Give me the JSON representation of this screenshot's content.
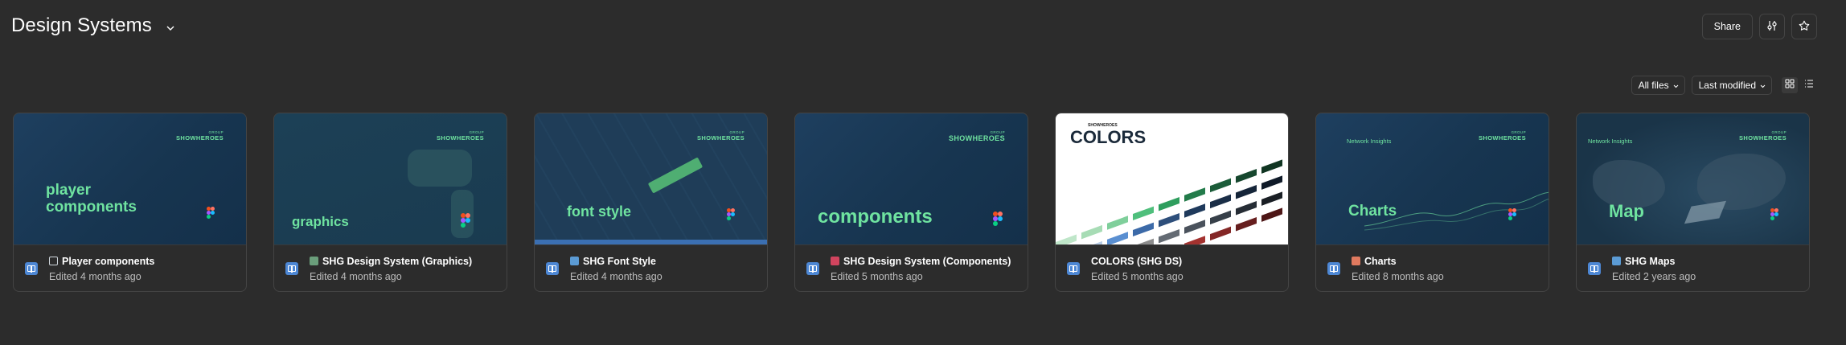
{
  "header": {
    "title": "Design Systems",
    "share_label": "Share"
  },
  "toolbar": {
    "filter_label": "All files",
    "sort_label": "Last modified"
  },
  "files": [
    {
      "title": "Player components",
      "edited": "Edited 4 months ago",
      "thumb_text": "player\ncomponents",
      "emoji_color": "#9aa4ad"
    },
    {
      "title": "SHG Design System (Graphics)",
      "edited": "Edited 4 months ago",
      "thumb_text": "graphics",
      "emoji_color": "#6a9e7b"
    },
    {
      "title": "SHG Font Style",
      "edited": "Edited 4 months ago",
      "thumb_text": "font style",
      "emoji_color": "#5b9bd5"
    },
    {
      "title": "SHG Design System (Components)",
      "edited": "Edited 5 months ago",
      "thumb_text": "components",
      "emoji_color": "#d1445e"
    },
    {
      "title": "COLORS (SHG DS)",
      "edited": "Edited 5 months ago",
      "thumb_text": "COLORS",
      "emoji_color": ""
    },
    {
      "title": "Charts",
      "edited": "Edited 8 months ago",
      "thumb_text": "Charts",
      "emoji_color": "#e07a5f"
    },
    {
      "title": "SHG Maps",
      "edited": "Edited 2 years ago",
      "thumb_text": "Map",
      "emoji_color": "#5b9bd5"
    }
  ],
  "brand": {
    "name": "SHOWHEROES",
    "group": "GROUP",
    "insights": "Network Insights"
  },
  "colors": {
    "background": "#2c2c2c",
    "accent_green": "#6fe3a0",
    "file_icon_blue": "#4d87d4"
  }
}
